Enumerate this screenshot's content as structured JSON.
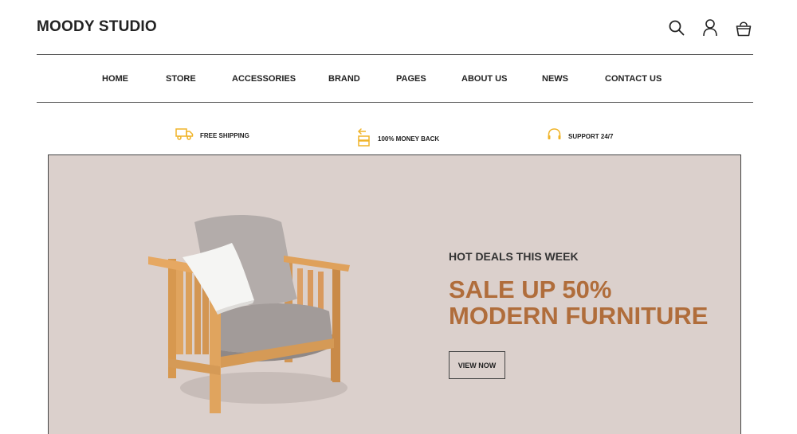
{
  "header": {
    "logo": "MOODY STUDIO",
    "icons": [
      "search-icon",
      "user-icon",
      "cart-icon"
    ]
  },
  "nav": {
    "items": [
      {
        "label": "HOME"
      },
      {
        "label": "STORE"
      },
      {
        "label": "ACCESSORIES"
      },
      {
        "label": "BRAND"
      },
      {
        "label": "PAGES"
      },
      {
        "label": "ABOUT US"
      },
      {
        "label": "NEWS"
      },
      {
        "label": "CONTACT US"
      }
    ]
  },
  "features": [
    {
      "label": "FREE SHIPPING",
      "icon": "truck-icon"
    },
    {
      "label": "100% MONEY BACK",
      "icon": "money-back-icon"
    },
    {
      "label": "SUPPORT 24/7",
      "icon": "headset-icon"
    }
  ],
  "hero": {
    "kicker": "HOT DEALS THIS WEEK",
    "title_line1": "SALE UP 50%",
    "title_line2": "MODERN FURNITURE",
    "button": "VIEW NOW",
    "image": "armchair-image"
  },
  "colors": {
    "accent": "#f0b429",
    "hero_bg": "#dbd0cc",
    "hero_title": "#b06d3b",
    "text": "#222222"
  }
}
